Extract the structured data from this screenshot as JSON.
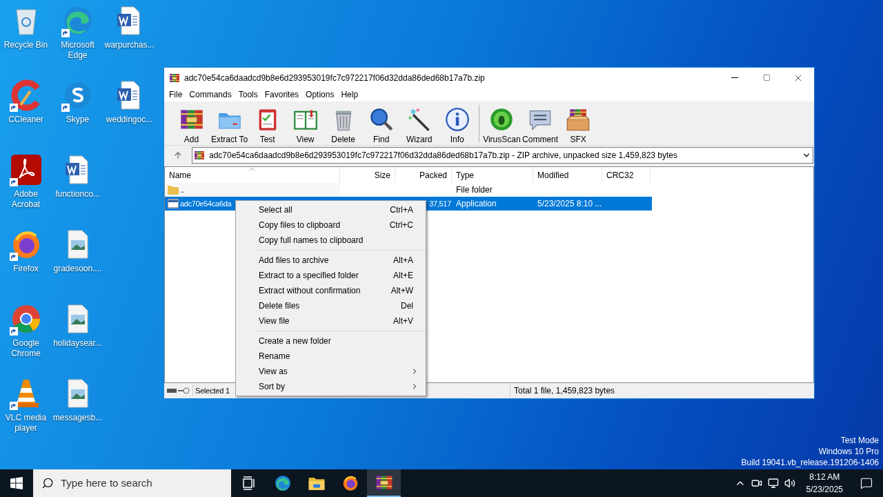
{
  "desktop_columns": [
    [
      {
        "label": "Recycle Bin",
        "kind": "recycle",
        "shortcut": false
      },
      {
        "label": "CCleaner",
        "kind": "ccleaner",
        "shortcut": true
      },
      {
        "label": "Adobe Acrobat",
        "kind": "acrobat",
        "shortcut": true
      },
      {
        "label": "Firefox",
        "kind": "firefox",
        "shortcut": true
      },
      {
        "label": "Google Chrome",
        "kind": "chrome",
        "shortcut": true
      },
      {
        "label": "VLC media player",
        "kind": "vlc",
        "shortcut": true
      }
    ],
    [
      {
        "label": "Microsoft Edge",
        "kind": "edge",
        "shortcut": true
      },
      {
        "label": "Skype",
        "kind": "skype",
        "shortcut": true
      },
      {
        "label": "functionco...",
        "kind": "word",
        "shortcut": false
      },
      {
        "label": "gradesoon....",
        "kind": "image",
        "shortcut": false
      },
      {
        "label": "holidaysear...",
        "kind": "image",
        "shortcut": false
      },
      {
        "label": "messagesb...",
        "kind": "image",
        "shortcut": false
      }
    ],
    [
      {
        "label": "warpurchas...",
        "kind": "word",
        "shortcut": false
      },
      {
        "label": "weddingoc...",
        "kind": "word",
        "shortcut": false
      }
    ]
  ],
  "window": {
    "title": "adc70e54ca6daadcd9b8e6d293953019fc7c972217f06d32dda86ded68b17a7b.zip",
    "menu": [
      "File",
      "Commands",
      "Tools",
      "Favorites",
      "Options",
      "Help"
    ],
    "toolbar": [
      [
        {
          "label": "Add",
          "kind": "add"
        },
        {
          "label": "Extract To",
          "kind": "extract"
        },
        {
          "label": "Test",
          "kind": "test"
        },
        {
          "label": "View",
          "kind": "view"
        },
        {
          "label": "Delete",
          "kind": "delete"
        },
        {
          "label": "Find",
          "kind": "find"
        },
        {
          "label": "Wizard",
          "kind": "wizard"
        },
        {
          "label": "Info",
          "kind": "info"
        }
      ],
      [
        {
          "label": "VirusScan",
          "kind": "virus"
        },
        {
          "label": "Comment",
          "kind": "comment"
        },
        {
          "label": "SFX",
          "kind": "sfx"
        }
      ]
    ],
    "address": "adc70e54ca6daadcd9b8e6d293953019fc7c972217f06d32dda86ded68b17a7b.zip - ZIP archive, unpacked size 1,459,823 bytes",
    "columns": [
      {
        "label": "Name",
        "sorted": true
      },
      {
        "label": "Size",
        "sorted": false
      },
      {
        "label": "Packed",
        "sorted": false
      },
      {
        "label": "Type",
        "sorted": false
      },
      {
        "label": "Modified",
        "sorted": false
      },
      {
        "label": "CRC32",
        "sorted": false
      }
    ],
    "rows": [
      {
        "kind": "folder",
        "name": "..",
        "type": "File folder",
        "selected": false
      },
      {
        "kind": "app",
        "name": "adc70e54ca6da",
        "packed": "37,517",
        "type": "Application",
        "modified": "5/23/2025 8:10 ...",
        "selected": true
      }
    ],
    "status_left": "Selected 1",
    "status_right": "Total 1 file, 1,459,823 bytes"
  },
  "context_menu": [
    [
      {
        "label": "Select all",
        "shortcut": "Ctrl+A",
        "submenu": false
      },
      {
        "label": "Copy files to clipboard",
        "shortcut": "Ctrl+C",
        "submenu": false
      },
      {
        "label": "Copy full names to clipboard",
        "submenu": false
      }
    ],
    [
      {
        "label": "Add files to archive",
        "shortcut": "Alt+A",
        "submenu": false
      },
      {
        "label": "Extract to a specified folder",
        "shortcut": "Alt+E",
        "submenu": false
      },
      {
        "label": "Extract without confirmation",
        "shortcut": "Alt+W",
        "submenu": false
      },
      {
        "label": "Delete files",
        "shortcut": "Del",
        "submenu": false
      },
      {
        "label": "View file",
        "shortcut": "Alt+V",
        "submenu": false
      }
    ],
    [
      {
        "label": "Create a new folder",
        "submenu": false
      },
      {
        "label": "Rename",
        "submenu": false
      },
      {
        "label": "View as",
        "submenu": true
      },
      {
        "label": "Sort by",
        "submenu": true
      }
    ]
  ],
  "system_notice": [
    "Test Mode",
    "Windows 10 Pro",
    "Build 19041.vb_release.191206-1406"
  ],
  "taskbar": {
    "search_placeholder": "Type here to search",
    "apps": [
      {
        "kind": "taskview",
        "active": false
      },
      {
        "kind": "edge",
        "active": false
      },
      {
        "kind": "explorer",
        "active": false
      },
      {
        "kind": "firefox",
        "active": false
      },
      {
        "kind": "winrar",
        "active": true
      }
    ],
    "time": "8:12 AM",
    "date": "5/23/2025"
  }
}
